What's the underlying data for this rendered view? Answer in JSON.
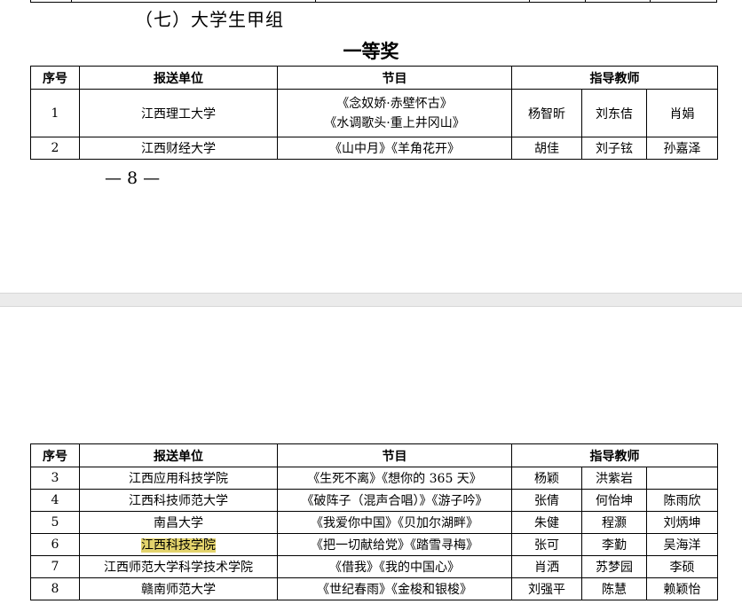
{
  "section_title": "（七）大学生甲组",
  "prize_title": "一等奖",
  "page_number": "— 8 —",
  "headers": {
    "seq": "序号",
    "unit": "报送单位",
    "program": "节目",
    "teacher": "指导教师"
  },
  "table1": [
    {
      "seq": "1",
      "unit": "江西理工大学",
      "programs": [
        "《念奴娇·赤壁怀古》",
        "《水调歌头·重上井冈山》"
      ],
      "teachers": [
        "杨智昕",
        "刘东佶",
        "肖娟"
      ]
    },
    {
      "seq": "2",
      "unit": "江西财经大学",
      "programs": [
        "《山中月》《羊角花开》"
      ],
      "teachers": [
        "胡佳",
        "刘子铉",
        "孙嘉泽"
      ]
    }
  ],
  "table2": [
    {
      "seq": "3",
      "unit": "江西应用科技学院",
      "program": "《生死不离》《想你的 365 天》",
      "teachers": [
        "杨颖",
        "洪紫岩",
        ""
      ]
    },
    {
      "seq": "4",
      "unit": "江西科技师范大学",
      "program": "《破阵子（混声合唱）》《游子吟》",
      "teachers": [
        "张倩",
        "何怡坤",
        "陈雨欣"
      ]
    },
    {
      "seq": "5",
      "unit": "南昌大学",
      "program": "《我爱你中国》《贝加尔湖畔》",
      "teachers": [
        "朱健",
        "程灏",
        "刘炳坤"
      ]
    },
    {
      "seq": "6",
      "unit": "江西科技学院",
      "program": "《把一切献给党》《踏雪寻梅》",
      "teachers": [
        "张可",
        "李勤",
        "吴海洋"
      ],
      "highlight": true
    },
    {
      "seq": "7",
      "unit": "江西师范大学科学技术学院",
      "program": "《借我》《我的中国心》",
      "teachers": [
        "肖洒",
        "苏梦园",
        "李硕"
      ]
    },
    {
      "seq": "8",
      "unit": "赣南师范大学",
      "program": "《世纪春雨》《金梭和银梭》",
      "teachers": [
        "刘强平",
        "陈慧",
        "赖颖怡"
      ]
    }
  ],
  "highlight_color": "#e3d36c"
}
